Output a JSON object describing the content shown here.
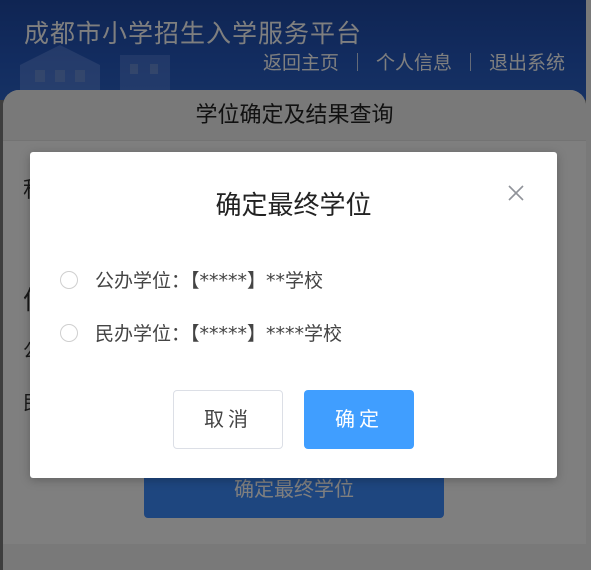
{
  "header": {
    "title": "成都市小学招生入学服务平台",
    "nav": [
      "返回主页",
      "个人信息",
      "退出系统"
    ]
  },
  "panel": {
    "title": "学位确定及结果查询",
    "final_button_label": "确定最终学位",
    "fragments": [
      "积",
      "信",
      "公",
      "民"
    ]
  },
  "dialog": {
    "title": "确定最终学位",
    "close_icon": "close-icon",
    "options": [
      {
        "label": "公办学位：【*****】**学校",
        "checked": false
      },
      {
        "label": "民办学位：【*****】****学校",
        "checked": false
      }
    ],
    "cancel_label": "取消",
    "confirm_label": "确定"
  },
  "colors": {
    "header_blue": "#2559c0",
    "primary": "#409eff",
    "overlay": "rgba(0,0,0,0.5)"
  }
}
